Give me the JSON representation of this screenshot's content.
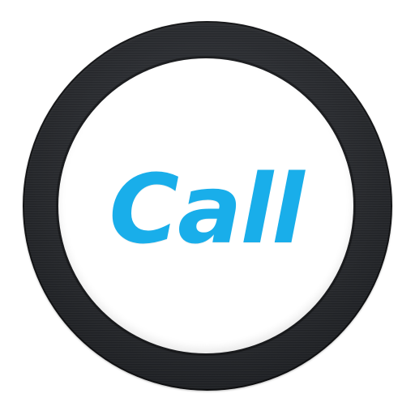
{
  "button": {
    "label": "Call"
  },
  "colors": {
    "label": "#19aeea",
    "ring": "#26282c",
    "face": "#ffffff"
  },
  "icons": {
    "ring": "metal-ring-icon"
  }
}
